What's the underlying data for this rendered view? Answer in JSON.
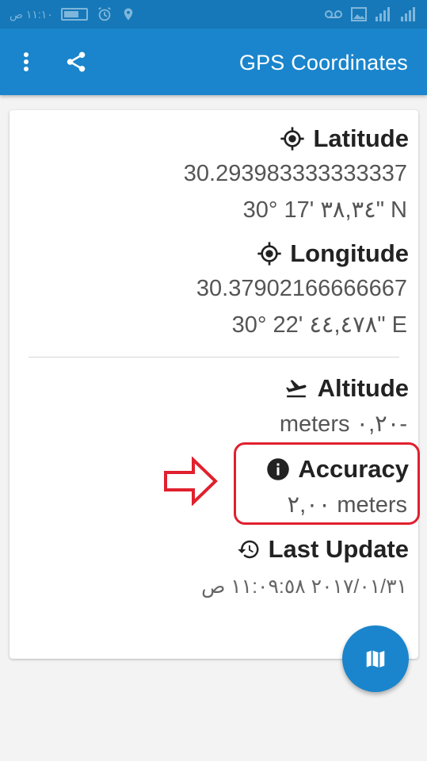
{
  "status_bar": {
    "time": "١١:١٠ ص"
  },
  "app_bar": {
    "title": "GPS Coordinates",
    "menu_icon": "more-vert-icon",
    "share_icon": "share-icon"
  },
  "latitude": {
    "heading": "Latitude",
    "icon": "gps-fixed-icon",
    "decimal": "30.293983333333337",
    "dms": "30° 17' ٣٨,٣٤\" N"
  },
  "longitude": {
    "heading": "Longitude",
    "icon": "gps-fixed-icon",
    "decimal": "30.37902166666667",
    "dms": "30° 22' ٤٤,٤٧٨\" E"
  },
  "altitude": {
    "heading": "Altitude",
    "icon": "flight-takeoff-icon",
    "value": "meters ٠,٢٠-"
  },
  "accuracy": {
    "heading": "Accuracy",
    "icon": "info-icon",
    "value": "٢,٠٠ meters"
  },
  "last_update": {
    "heading": "Last Update",
    "icon": "history-icon",
    "value": "٢٠١٧/٠١/٣١ ١١:٠٩:٥٨ ص"
  },
  "fab": {
    "icon": "map-icon"
  },
  "colors": {
    "status_bar": "#1678b8",
    "app_bar": "#1a85cc",
    "highlight": "#e0202e"
  }
}
